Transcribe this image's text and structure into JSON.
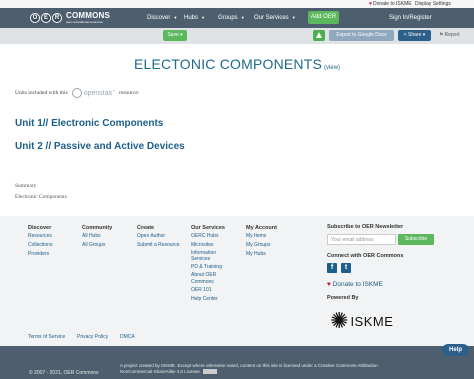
{
  "utility": {
    "donate_label": "Donate to ISKME",
    "display_settings_label": "Display Settings"
  },
  "nav": {
    "logo_letters": [
      "O",
      "E",
      "R"
    ],
    "logo_title": "COMMONS",
    "logo_subtitle": "open educational resources",
    "discover_label": "Discover",
    "hubs_label": "Hubs",
    "groups_label": "Groups",
    "services_label": "Our Services",
    "add_oer_label": "Add OER",
    "sign_in_label": "Sign In/Register"
  },
  "actions": {
    "save_label": "Save",
    "export_label": "Export to Google Docs",
    "share_label": "Share",
    "report_label": "Report"
  },
  "page": {
    "title": "ELECTONIC COMPONENTS",
    "view_label": "(view)",
    "units_prefix": "Units included with this",
    "units_suffix": "resource:",
    "openstax_label": "openstax",
    "units": [
      {
        "label": "Unit 1// Electronic Components"
      },
      {
        "label": "Unit 2 // Passive and Active Devices"
      }
    ],
    "summary_label": "Summary",
    "summary_text": "Electronic Components"
  },
  "footer": {
    "discover": {
      "heading": "Discover",
      "links": [
        "Resources",
        "Collections",
        "Providers"
      ]
    },
    "community": {
      "heading": "Community",
      "links": [
        "All Hubs",
        "All Groups"
      ]
    },
    "create": {
      "heading": "Create",
      "links": [
        "Open Author",
        "Submit a Resource"
      ]
    },
    "services": {
      "heading": "Our Services",
      "links": [
        "OERC Hubs",
        "Microsites",
        "Information",
        "Services",
        "PD & Training",
        "About OER",
        "Commons",
        "OER 101",
        "Help Center"
      ]
    },
    "account": {
      "heading": "My Account",
      "links": [
        "My Items",
        "My Groups",
        "My Hubs"
      ]
    },
    "newsletter_heading": "Subscribe to OER Newsletter",
    "email_placeholder": "Your email address",
    "subscribe_label": "Subscribe",
    "connect_heading": "Connect with OER Commons",
    "facebook_glyph": "f",
    "twitter_glyph": "t",
    "donate_label": "Donate to ISKME",
    "powered_heading": "Powered By",
    "iskme_label": "ISKME",
    "bottom_links": [
      "Terms of Service",
      "Privacy Policy",
      "DMCA"
    ],
    "legal_line1": "A project created by ISKME. Except where otherwise noted, content on this site is licensed under a Creative Commons Attribution",
    "legal_line2": "NonCommercial-ShareAlike 4.0 License.",
    "copyright": "© 2007 - 2021, OER Commons",
    "help_label": "Help"
  }
}
